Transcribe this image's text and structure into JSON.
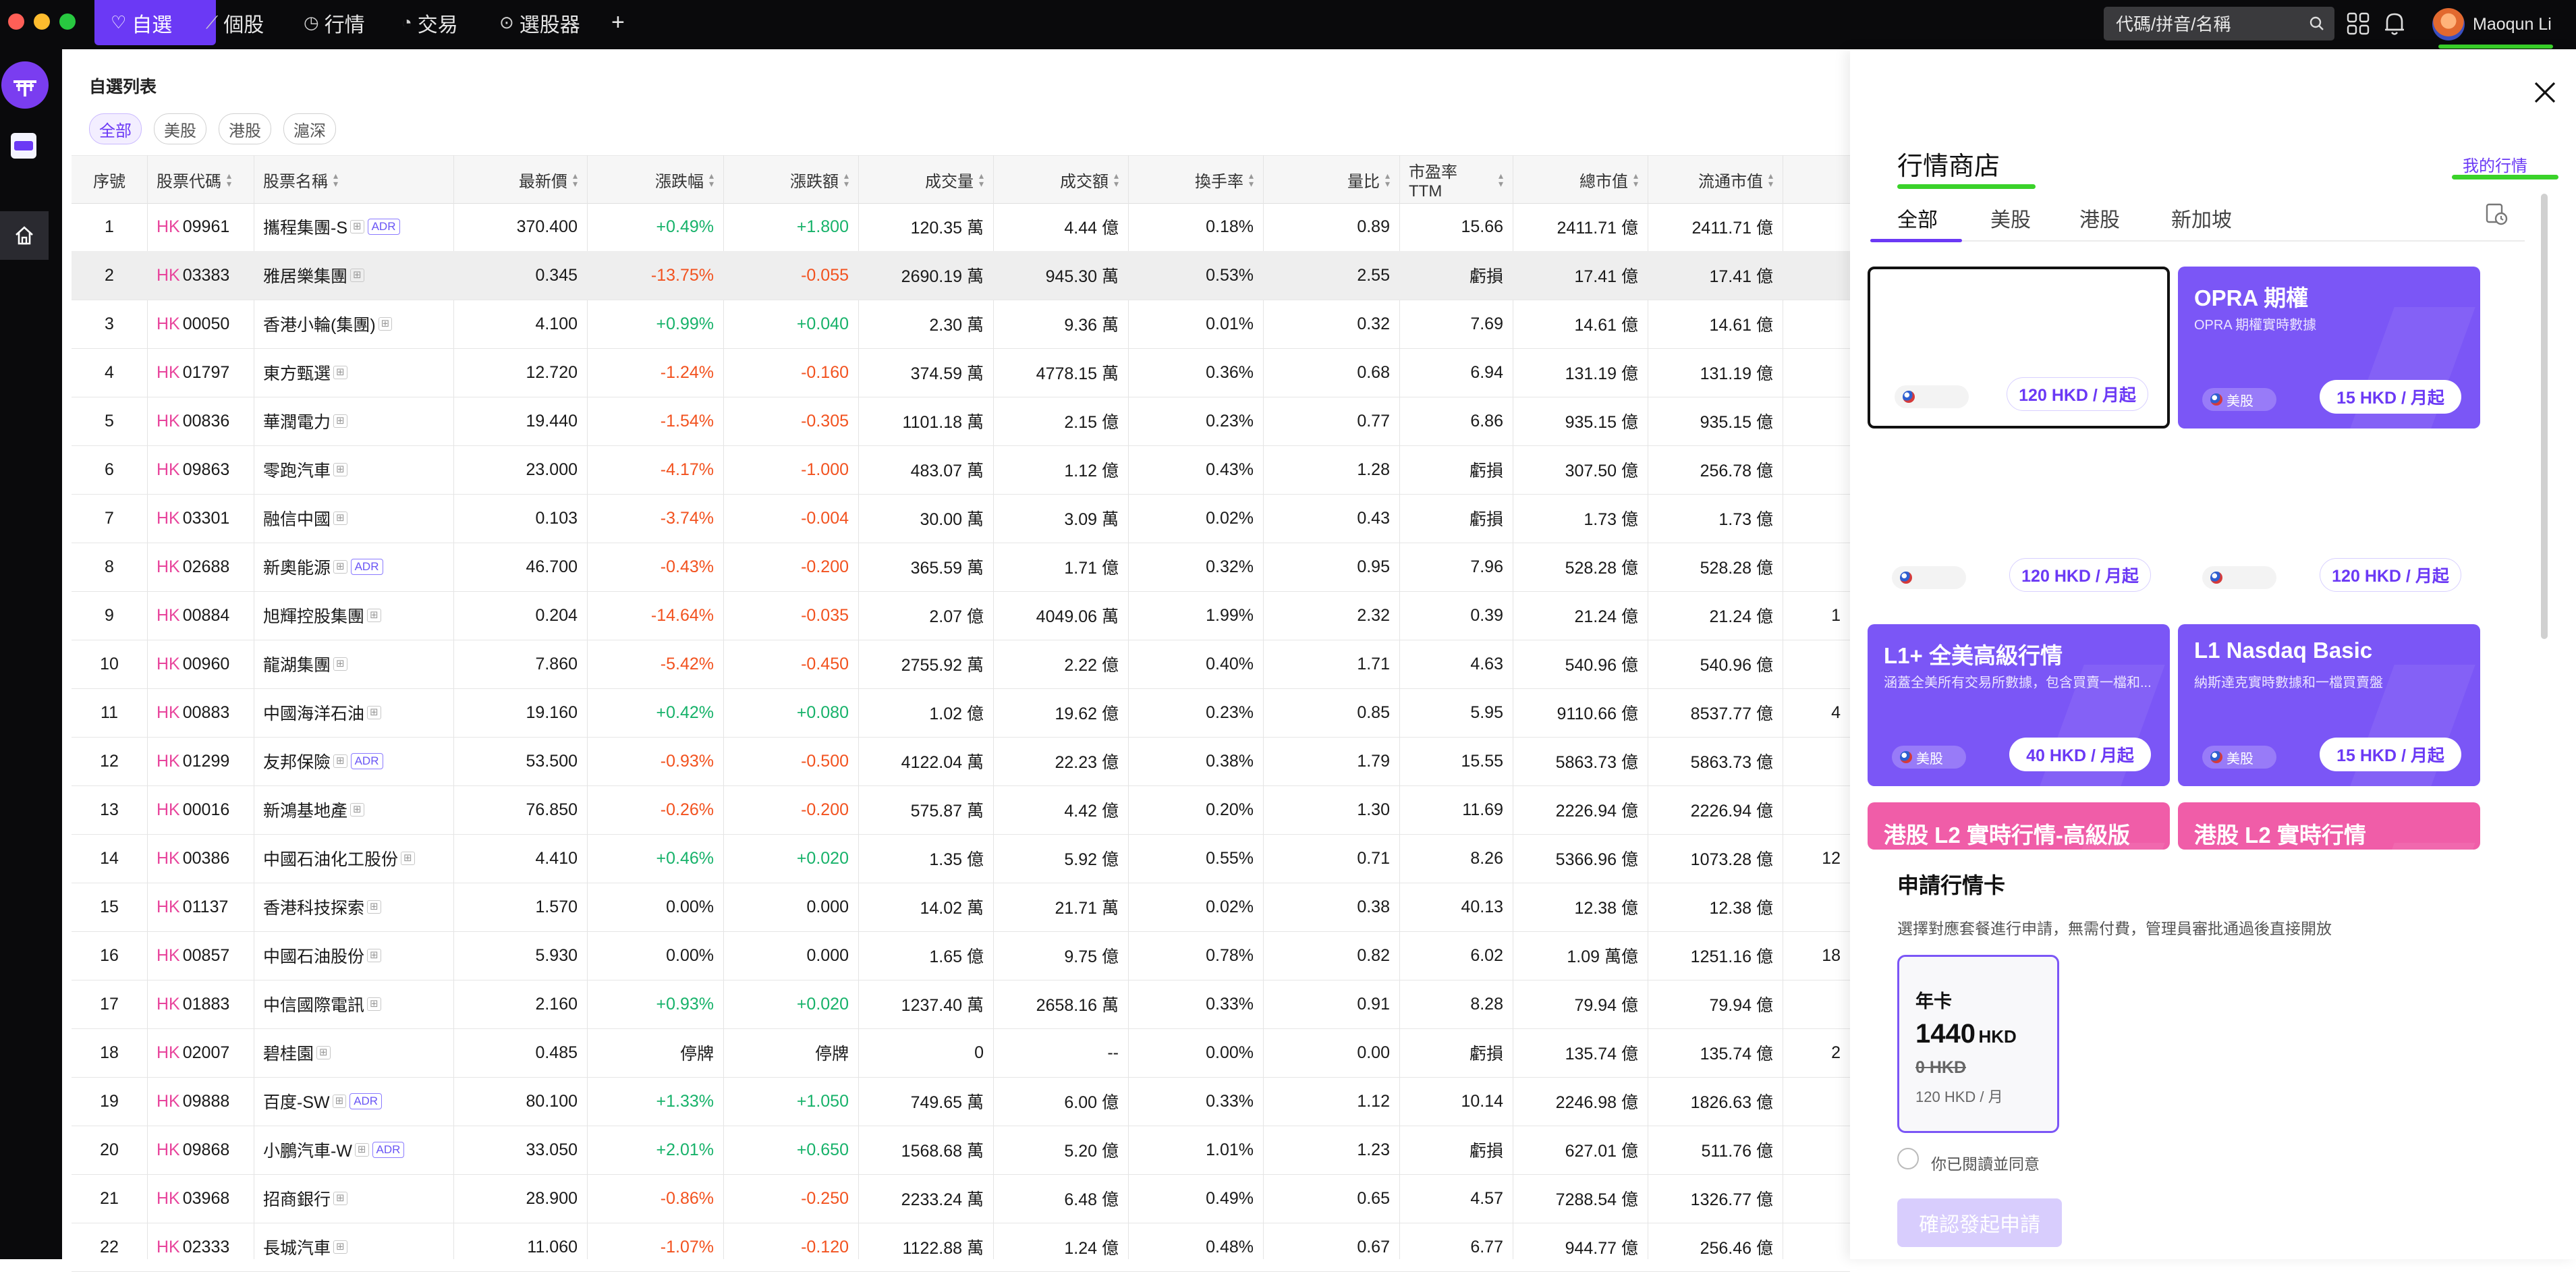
{
  "topbar": {
    "tabs": [
      {
        "label": "自選",
        "icon": "heart-icon"
      },
      {
        "label": "個股",
        "icon": "chart-line-icon"
      },
      {
        "label": "行情",
        "icon": "clock-icon"
      },
      {
        "label": "交易",
        "icon": "pie-icon"
      },
      {
        "label": "選股器",
        "icon": "compass-icon"
      }
    ],
    "add_label": "+",
    "search_placeholder": "代碼/拼音/名稱",
    "user_name": "Maoqun Li"
  },
  "watchlist": {
    "title": "自選列表",
    "filters": [
      "全部",
      "美股",
      "港股",
      "滬深"
    ],
    "active_filter": "全部",
    "columns": [
      "序號",
      "股票代碼",
      "股票名稱",
      "最新價",
      "漲跌幅",
      "漲跌額",
      "成交量",
      "成交額",
      "換手率",
      "量比",
      "市盈率 TTM",
      "總市值",
      "流通市值"
    ],
    "rows": [
      {
        "no": "1",
        "mkt": "HK",
        "code": "09961",
        "name": "攜程集團-S",
        "adr": true,
        "price": "370.400",
        "chg_pct": "+0.49%",
        "chg": "+1.800",
        "dir": "pos",
        "vol": "120.35 萬",
        "amt": "4.44 億",
        "turnover": "0.18%",
        "ratio": "0.89",
        "pe": "15.66",
        "mcap": "2411.71 億",
        "float": "2411.71 億",
        "extra": ""
      },
      {
        "no": "2",
        "mkt": "HK",
        "code": "03383",
        "name": "雅居樂集團",
        "adr": false,
        "price": "0.345",
        "chg_pct": "-13.75%",
        "chg": "-0.055",
        "dir": "neg",
        "vol": "2690.19 萬",
        "amt": "945.30 萬",
        "turnover": "0.53%",
        "ratio": "2.55",
        "pe": "虧損",
        "mcap": "17.41 億",
        "float": "17.41 億",
        "extra": ""
      },
      {
        "no": "3",
        "mkt": "HK",
        "code": "00050",
        "name": "香港小輪(集團)",
        "adr": false,
        "price": "4.100",
        "chg_pct": "+0.99%",
        "chg": "+0.040",
        "dir": "pos",
        "vol": "2.30 萬",
        "amt": "9.36 萬",
        "turnover": "0.01%",
        "ratio": "0.32",
        "pe": "7.69",
        "mcap": "14.61 億",
        "float": "14.61 億",
        "extra": ""
      },
      {
        "no": "4",
        "mkt": "HK",
        "code": "01797",
        "name": "東方甄選",
        "adr": false,
        "price": "12.720",
        "chg_pct": "-1.24%",
        "chg": "-0.160",
        "dir": "neg",
        "vol": "374.59 萬",
        "amt": "4778.15 萬",
        "turnover": "0.36%",
        "ratio": "0.68",
        "pe": "6.94",
        "mcap": "131.19 億",
        "float": "131.19 億",
        "extra": ""
      },
      {
        "no": "5",
        "mkt": "HK",
        "code": "00836",
        "name": "華潤電力",
        "adr": false,
        "price": "19.440",
        "chg_pct": "-1.54%",
        "chg": "-0.305",
        "dir": "neg",
        "vol": "1101.18 萬",
        "amt": "2.15 億",
        "turnover": "0.23%",
        "ratio": "0.77",
        "pe": "6.86",
        "mcap": "935.15 億",
        "float": "935.15 億",
        "extra": ""
      },
      {
        "no": "6",
        "mkt": "HK",
        "code": "09863",
        "name": "零跑汽車",
        "adr": false,
        "price": "23.000",
        "chg_pct": "-4.17%",
        "chg": "-1.000",
        "dir": "neg",
        "vol": "483.07 萬",
        "amt": "1.12 億",
        "turnover": "0.43%",
        "ratio": "1.28",
        "pe": "虧損",
        "mcap": "307.50 億",
        "float": "256.78 億",
        "extra": ""
      },
      {
        "no": "7",
        "mkt": "HK",
        "code": "03301",
        "name": "融信中國",
        "adr": false,
        "price": "0.103",
        "chg_pct": "-3.74%",
        "chg": "-0.004",
        "dir": "neg",
        "vol": "30.00 萬",
        "amt": "3.09 萬",
        "turnover": "0.02%",
        "ratio": "0.43",
        "pe": "虧損",
        "mcap": "1.73 億",
        "float": "1.73 億",
        "extra": ""
      },
      {
        "no": "8",
        "mkt": "HK",
        "code": "02688",
        "name": "新奧能源",
        "adr": true,
        "price": "46.700",
        "chg_pct": "-0.43%",
        "chg": "-0.200",
        "dir": "neg",
        "vol": "365.59 萬",
        "amt": "1.71 億",
        "turnover": "0.32%",
        "ratio": "0.95",
        "pe": "7.96",
        "mcap": "528.28 億",
        "float": "528.28 億",
        "extra": ""
      },
      {
        "no": "9",
        "mkt": "HK",
        "code": "00884",
        "name": "旭輝控股集團",
        "adr": false,
        "price": "0.204",
        "chg_pct": "-14.64%",
        "chg": "-0.035",
        "dir": "neg",
        "vol": "2.07 億",
        "amt": "4049.06 萬",
        "turnover": "1.99%",
        "ratio": "2.32",
        "pe": "0.39",
        "mcap": "21.24 億",
        "float": "21.24 億",
        "extra": "1"
      },
      {
        "no": "10",
        "mkt": "HK",
        "code": "00960",
        "name": "龍湖集團",
        "adr": false,
        "price": "7.860",
        "chg_pct": "-5.42%",
        "chg": "-0.450",
        "dir": "neg",
        "vol": "2755.92 萬",
        "amt": "2.22 億",
        "turnover": "0.40%",
        "ratio": "1.71",
        "pe": "4.63",
        "mcap": "540.96 億",
        "float": "540.96 億",
        "extra": ""
      },
      {
        "no": "11",
        "mkt": "HK",
        "code": "00883",
        "name": "中國海洋石油",
        "adr": false,
        "price": "19.160",
        "chg_pct": "+0.42%",
        "chg": "+0.080",
        "dir": "pos",
        "vol": "1.02 億",
        "amt": "19.62 億",
        "turnover": "0.23%",
        "ratio": "0.85",
        "pe": "5.95",
        "mcap": "9110.66 億",
        "float": "8537.77 億",
        "extra": "4"
      },
      {
        "no": "12",
        "mkt": "HK",
        "code": "01299",
        "name": "友邦保險",
        "adr": true,
        "price": "53.500",
        "chg_pct": "-0.93%",
        "chg": "-0.500",
        "dir": "neg",
        "vol": "4122.04 萬",
        "amt": "22.23 億",
        "turnover": "0.38%",
        "ratio": "1.79",
        "pe": "15.55",
        "mcap": "5863.73 億",
        "float": "5863.73 億",
        "extra": ""
      },
      {
        "no": "13",
        "mkt": "HK",
        "code": "00016",
        "name": "新鴻基地產",
        "adr": false,
        "price": "76.850",
        "chg_pct": "-0.26%",
        "chg": "-0.200",
        "dir": "neg",
        "vol": "575.87 萬",
        "amt": "4.42 億",
        "turnover": "0.20%",
        "ratio": "1.30",
        "pe": "11.69",
        "mcap": "2226.94 億",
        "float": "2226.94 億",
        "extra": ""
      },
      {
        "no": "14",
        "mkt": "HK",
        "code": "00386",
        "name": "中國石油化工股份",
        "adr": false,
        "price": "4.410",
        "chg_pct": "+0.46%",
        "chg": "+0.020",
        "dir": "pos",
        "vol": "1.35 億",
        "amt": "5.92 億",
        "turnover": "0.55%",
        "ratio": "0.71",
        "pe": "8.26",
        "mcap": "5366.96 億",
        "float": "1073.28 億",
        "extra": "12"
      },
      {
        "no": "15",
        "mkt": "HK",
        "code": "01137",
        "name": "香港科技探索",
        "adr": false,
        "price": "1.570",
        "chg_pct": "0.00%",
        "chg": "0.000",
        "dir": "zero",
        "vol": "14.02 萬",
        "amt": "21.71 萬",
        "turnover": "0.02%",
        "ratio": "0.38",
        "pe": "40.13",
        "mcap": "12.38 億",
        "float": "12.38 億",
        "extra": ""
      },
      {
        "no": "16",
        "mkt": "HK",
        "code": "00857",
        "name": "中國石油股份",
        "adr": false,
        "price": "5.930",
        "chg_pct": "0.00%",
        "chg": "0.000",
        "dir": "zero",
        "vol": "1.65 億",
        "amt": "9.75 億",
        "turnover": "0.78%",
        "ratio": "0.82",
        "pe": "6.02",
        "mcap": "1.09 萬億",
        "float": "1251.16 億",
        "extra": "18"
      },
      {
        "no": "17",
        "mkt": "HK",
        "code": "01883",
        "name": "中信國際電訊",
        "adr": false,
        "price": "2.160",
        "chg_pct": "+0.93%",
        "chg": "+0.020",
        "dir": "pos",
        "vol": "1237.40 萬",
        "amt": "2658.16 萬",
        "turnover": "0.33%",
        "ratio": "0.91",
        "pe": "8.28",
        "mcap": "79.94 億",
        "float": "79.94 億",
        "extra": ""
      },
      {
        "no": "18",
        "mkt": "HK",
        "code": "02007",
        "name": "碧桂園",
        "adr": false,
        "price": "0.485",
        "chg_pct": "停牌",
        "chg": "停牌",
        "dir": "zero",
        "vol": "0",
        "amt": "--",
        "turnover": "0.00%",
        "ratio": "0.00",
        "pe": "虧損",
        "mcap": "135.74 億",
        "float": "135.74 億",
        "extra": "2"
      },
      {
        "no": "19",
        "mkt": "HK",
        "code": "09888",
        "name": "百度-SW",
        "adr": true,
        "price": "80.100",
        "chg_pct": "+1.33%",
        "chg": "+1.050",
        "dir": "pos",
        "vol": "749.65 萬",
        "amt": "6.00 億",
        "turnover": "0.33%",
        "ratio": "1.12",
        "pe": "10.14",
        "mcap": "2246.98 億",
        "float": "1826.63 億",
        "extra": ""
      },
      {
        "no": "20",
        "mkt": "HK",
        "code": "09868",
        "name": "小鵬汽車-W",
        "adr": true,
        "price": "33.050",
        "chg_pct": "+2.01%",
        "chg": "+0.650",
        "dir": "pos",
        "vol": "1568.68 萬",
        "amt": "5.20 億",
        "turnover": "1.01%",
        "ratio": "1.23",
        "pe": "虧損",
        "mcap": "627.01 億",
        "float": "511.76 億",
        "extra": ""
      },
      {
        "no": "21",
        "mkt": "HK",
        "code": "03968",
        "name": "招商銀行",
        "adr": false,
        "price": "28.900",
        "chg_pct": "-0.86%",
        "chg": "-0.250",
        "dir": "neg",
        "vol": "2233.24 萬",
        "amt": "6.48 億",
        "turnover": "0.49%",
        "ratio": "0.65",
        "pe": "4.57",
        "mcap": "7288.54 億",
        "float": "1326.77 億",
        "extra": ""
      },
      {
        "no": "22",
        "mkt": "HK",
        "code": "02333",
        "name": "長城汽車",
        "adr": false,
        "price": "11.060",
        "chg_pct": "-1.07%",
        "chg": "-0.120",
        "dir": "neg",
        "vol": "1122.88 萬",
        "amt": "1.24 億",
        "turnover": "0.48%",
        "ratio": "0.67",
        "pe": "6.77",
        "mcap": "944.77 億",
        "float": "256.46 億",
        "extra": ""
      }
    ]
  },
  "panel": {
    "title": "行情商店",
    "my_market": "我的行情",
    "tabs": [
      "全部",
      "美股",
      "港股",
      "新加坡"
    ],
    "active_tab": "全部",
    "cards": [
      {
        "title": "",
        "sub": "",
        "flag": "",
        "price": "120 HKD / 月起",
        "style": "blank"
      },
      {
        "title": "OPRA 期權",
        "sub": "OPRA 期權實時數據",
        "flag": "美股",
        "price": "15 HKD / 月起",
        "style": "purple"
      },
      {
        "title": "",
        "sub": "",
        "flag": "",
        "price": "120 HKD / 月起",
        "style": "hidden"
      },
      {
        "title": "",
        "sub": "",
        "flag": "",
        "price": "120 HKD / 月起",
        "style": "hidden"
      },
      {
        "title": "L1+ 全美高級行情",
        "sub": "涵蓋全美所有交易所數據，包含買賣一檔和...",
        "flag": "美股",
        "price": "40 HKD / 月起",
        "style": "purple"
      },
      {
        "title": "L1 Nasdaq Basic",
        "sub": "納斯達克實時數據和一檔買賣盤",
        "flag": "美股",
        "price": "15 HKD / 月起",
        "style": "purple"
      },
      {
        "title": "港股 L2 實時行情-高級版",
        "sub": "",
        "flag": "",
        "price": "",
        "style": "pink"
      },
      {
        "title": "港股 L2 實時行情",
        "sub": "",
        "flag": "",
        "price": "",
        "style": "pink"
      }
    ],
    "apply": {
      "title": "申請行情卡",
      "desc": "選擇對應套餐進行申請，無需付費，管理員審批通過後直接開放",
      "plan_name": "年卡",
      "plan_price": "1440",
      "plan_currency": "HKD",
      "plan_original": "0 HKD",
      "plan_monthly": "120 HKD / 月",
      "agree_label": "你已閱讀並同意",
      "confirm_label": "確認發起申請"
    }
  },
  "colors": {
    "accent": "#6b39f5",
    "up": "#17b26a",
    "down": "#f2521f",
    "hk_tag": "#e8449c",
    "highlight_underline": "#3ad22a"
  }
}
